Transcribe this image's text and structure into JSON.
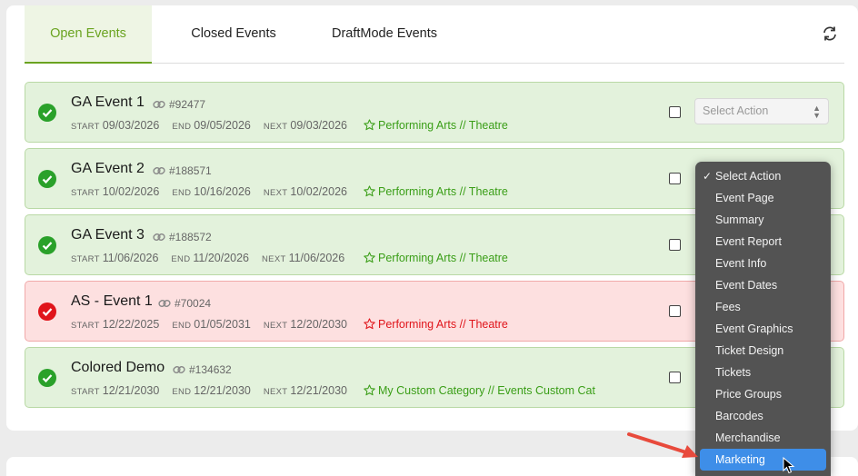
{
  "tabs": [
    {
      "label": "Open Events"
    },
    {
      "label": "Closed Events"
    },
    {
      "label": "DraftMode Events"
    }
  ],
  "icons": {
    "refresh": "refresh-icon",
    "status_ok": "check-circle-icon",
    "status_err": "check-circle-icon",
    "link": "link-icon",
    "category": "star-icon"
  },
  "colors": {
    "accent": "#6aa320",
    "ok_bg": "#e3f2dc",
    "err_bg": "#fde0e0",
    "ok_category": "#3a9e17",
    "err_category": "#e0151b",
    "highlight": "#3e8ee8"
  },
  "labels": {
    "start": "START",
    "end": "END",
    "next": "NEXT"
  },
  "events": [
    {
      "title": "GA Event 1",
      "id": "#92477",
      "start": "09/03/2026",
      "end": "09/05/2026",
      "next": "09/03/2026",
      "category": "Performing Arts // Theatre",
      "status": "ok"
    },
    {
      "title": "GA Event 2",
      "id": "#188571",
      "start": "10/02/2026",
      "end": "10/16/2026",
      "next": "10/02/2026",
      "category": "Performing Arts // Theatre",
      "status": "ok"
    },
    {
      "title": "GA Event 3",
      "id": "#188572",
      "start": "11/06/2026",
      "end": "11/20/2026",
      "next": "11/06/2026",
      "category": "Performing Arts // Theatre",
      "status": "ok"
    },
    {
      "title": "AS - Event 1",
      "id": "#70024",
      "start": "12/22/2025",
      "end": "01/05/2031",
      "next": "12/20/2030",
      "category": "Performing Arts // Theatre",
      "status": "error"
    },
    {
      "title": "Colored Demo",
      "id": "#134632",
      "start": "12/21/2030",
      "end": "12/21/2030",
      "next": "12/21/2030",
      "category": "My Custom Category // Events Custom Cat",
      "status": "ok"
    }
  ],
  "select_action": {
    "placeholder": "Select Action"
  },
  "dropdown": {
    "selected": "Select Action",
    "items": [
      "Select Action",
      "Event Page",
      "Summary",
      "Event Report",
      "Event Info",
      "Event Dates",
      "Fees",
      "Event Graphics",
      "Ticket Design",
      "Tickets",
      "Price Groups",
      "Barcodes",
      "Merchandise",
      "Marketing"
    ],
    "highlighted": "Marketing"
  }
}
